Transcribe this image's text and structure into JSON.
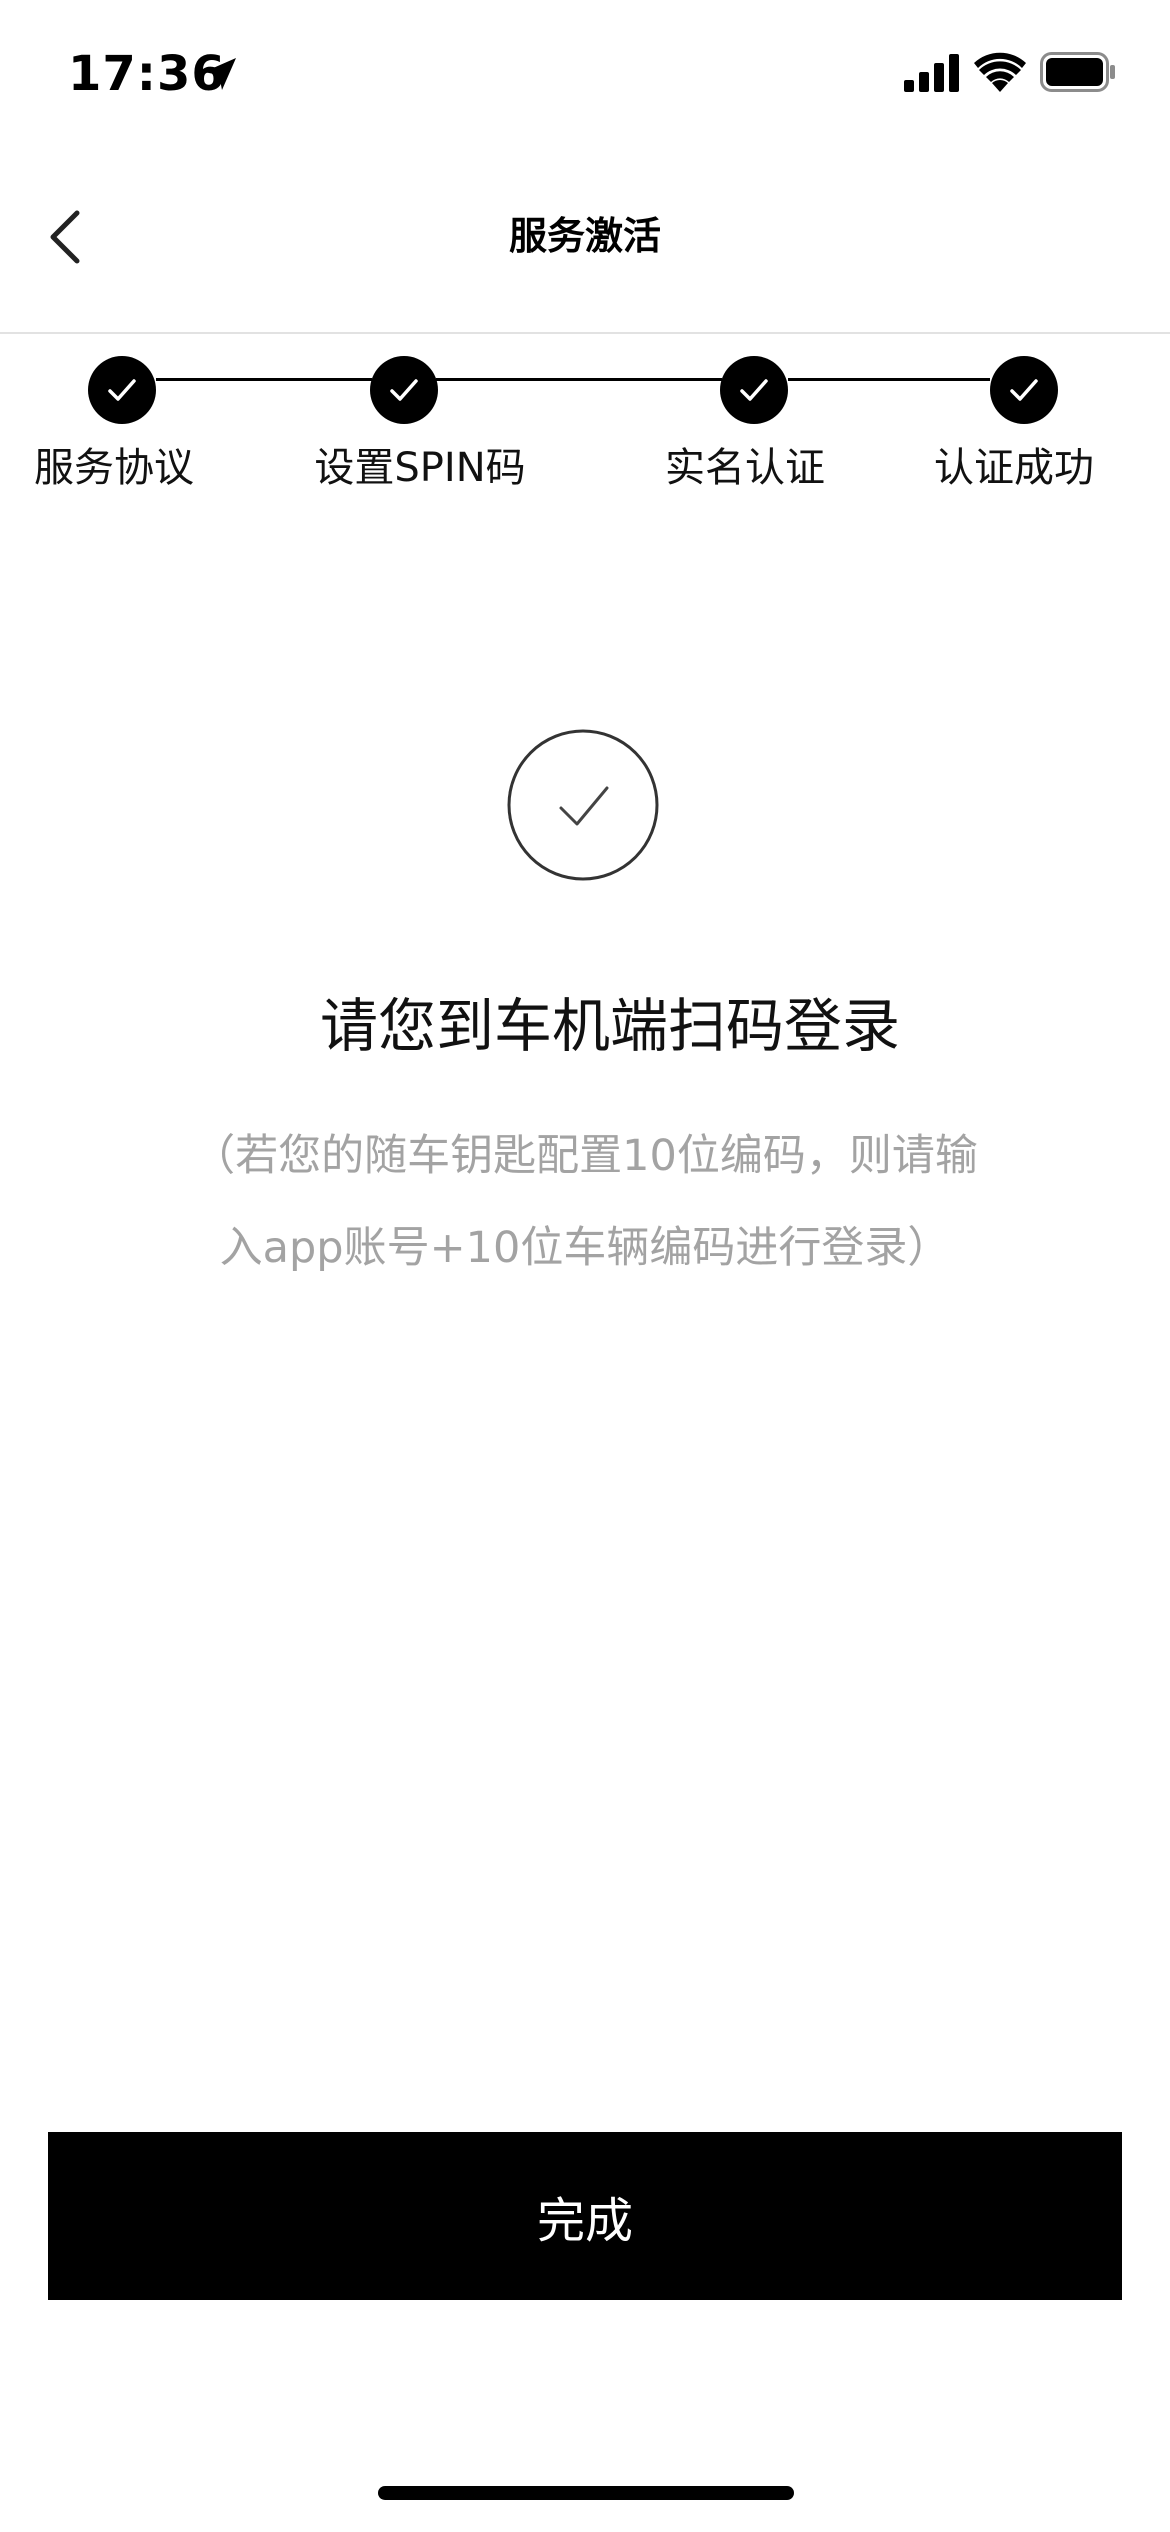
{
  "status_bar": {
    "time": "17:36",
    "icons": [
      "location-arrow-icon",
      "cellular-signal-icon",
      "wifi-icon",
      "battery-icon"
    ]
  },
  "nav": {
    "title": "服务激活",
    "back_icon": "chevron-left-icon"
  },
  "stepper": {
    "steps": [
      {
        "label": "服务协议",
        "completed": true
      },
      {
        "label": "设置SPIN码",
        "completed": true
      },
      {
        "label": "实名认证",
        "completed": true
      },
      {
        "label": "认证成功",
        "completed": true
      }
    ]
  },
  "content": {
    "status_icon": "check-circle-icon",
    "message": "请您到车机端扫码登录",
    "hint_line1": "（若您的随车钥匙配置10位编码，则请输",
    "hint_line2": "入app账号+10位车辆编码进行登录）"
  },
  "footer": {
    "done_label": "完成"
  },
  "colors": {
    "primary": "#000000",
    "background": "#ffffff",
    "hint_text": "#a3a3a3",
    "divider": "#e2e2e2"
  }
}
